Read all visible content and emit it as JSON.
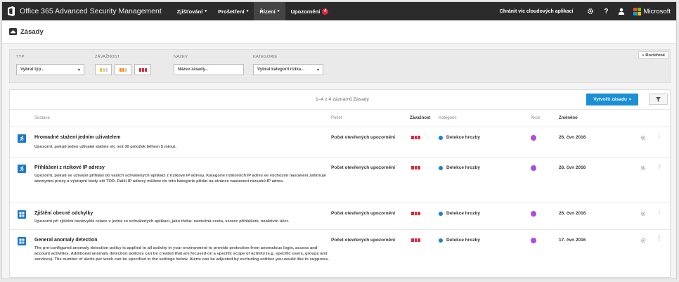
{
  "app_title": "Office 365 Advanced Security Management",
  "nav": [
    {
      "label": "Zjišťování",
      "caret": "▾"
    },
    {
      "label": "Prošetření",
      "caret": "▾"
    },
    {
      "label": "Řízení",
      "caret": "▾"
    },
    {
      "label": "Upozornění",
      "badge": "4"
    }
  ],
  "top_right": {
    "protect_link": "Chránit víc cloudových aplikací",
    "settings_icon": "gear-icon",
    "help_label": "?",
    "user_icon": "user-icon",
    "brand": "Microsoft",
    "brand_colors": [
      "#f25022",
      "#7fba00",
      "#00a4ef",
      "#ffb900"
    ]
  },
  "page": {
    "title": "Zásady"
  },
  "filters": {
    "type_label": "TYP",
    "type_placeholder": "Vybrat typ...",
    "severity_label": "ZÁVAŽNOST",
    "name_label": "NÁZEV",
    "name_placeholder": "Název zásady...",
    "category_label": "KATEGORIE",
    "category_placeholder": "Vybrat kategorii rizika...",
    "advanced": "Rozšířené",
    "dropdown_caret": "▾",
    "severity_colors": {
      "low": "#f2c500",
      "medium": "#ff8c1a",
      "high": "#e0253b",
      "inactive": "#cfcfcf"
    }
  },
  "table": {
    "count_text": "1–4 z 4 záznamů Zásady",
    "create_button": "Vytvořit zásadu",
    "create_caret": "▾",
    "headers": {
      "policy": "Sestava",
      "count": "Počet",
      "severity": "Závažnost",
      "category": "Kategorie",
      "action": "Akce",
      "modified": "Změněno"
    },
    "rows": [
      {
        "icon": "run",
        "name": "Hromadné stažení jedním uživatelem",
        "description": "Upozorní, pokud jeden uživatel stáhne víc než 30 položek během 5 minut.",
        "count": "Počet otevřených upozornění",
        "category": "Detekce hrozby",
        "modified": "26. čvn 2016"
      },
      {
        "icon": "run",
        "name": "Přihlášení z rizikové IP adresy",
        "description": "Upozorní, pokud se uživatel přihlásí do vašich schválených aplikací z rizikové IP adresy. Kategorie rizikových IP adres ve výchozím nastavení zahrnuje anonymní proxy a výstupní body sítí TOR. Další IP adresy můžete do této kategorie přidat na stránce nastavení rozsahů IP adres.",
        "count": "Počet otevřených upozornění",
        "category": "Detekce hrozby",
        "modified": "26. čvn 2016"
      },
      {
        "icon": "grid",
        "name": "Zjištění obecné odchylky",
        "description": "Upozorní při zjištění neobvyklé relace v jedné ze schválených aplikací, jako třeba: nemožná cesta, vzorec přihlášení, neaktivní účet.",
        "count": "Počet otevřených upozornění",
        "category": "Detekce hrozby",
        "modified": "26. čvn 2016"
      },
      {
        "icon": "grid",
        "name": "General anomaly detection",
        "description": "The pre-configured anomaly detection policy is applied to all activity in your environment to provide protection from anomalous login, access and account activities. Additional anomaly detection policies can be created that are focused on a specific scope of activity (e.g. specific users, groups and services). The number of alerts per week can be specified in the settings below. Alerts can be adjusted by excluding entities you would like to suppress.",
        "count": "Počet otevřených upozornění",
        "category": "Detekce hrozby",
        "modified": "17. čvn 2016"
      }
    ]
  }
}
